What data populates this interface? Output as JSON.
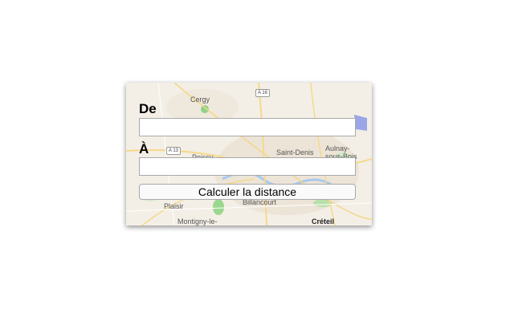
{
  "widget": {
    "from_label": "De",
    "from_value": "",
    "to_label": "À",
    "to_value": "",
    "calculate_button_label": "Calculer la distance"
  },
  "map": {
    "labels": {
      "cergy": "Cergy",
      "saint_denis": "Saint-Denis",
      "aulnay": "Aulnay-",
      "aulnay2": "sous-Bois",
      "poissy": "Poissy",
      "plaisir": "Plaisir",
      "billancourt": "Billancourt",
      "montigny": "Montigny-le-",
      "creteil": "Créteil"
    },
    "roads": {
      "a16": "A 16",
      "a13": "A 13"
    },
    "colors": {
      "land": "#f3efe6",
      "park": "#bfe3b4",
      "water": "#a9c9ee",
      "road": "#f6d98a",
      "urban": "#ece6dc"
    }
  }
}
